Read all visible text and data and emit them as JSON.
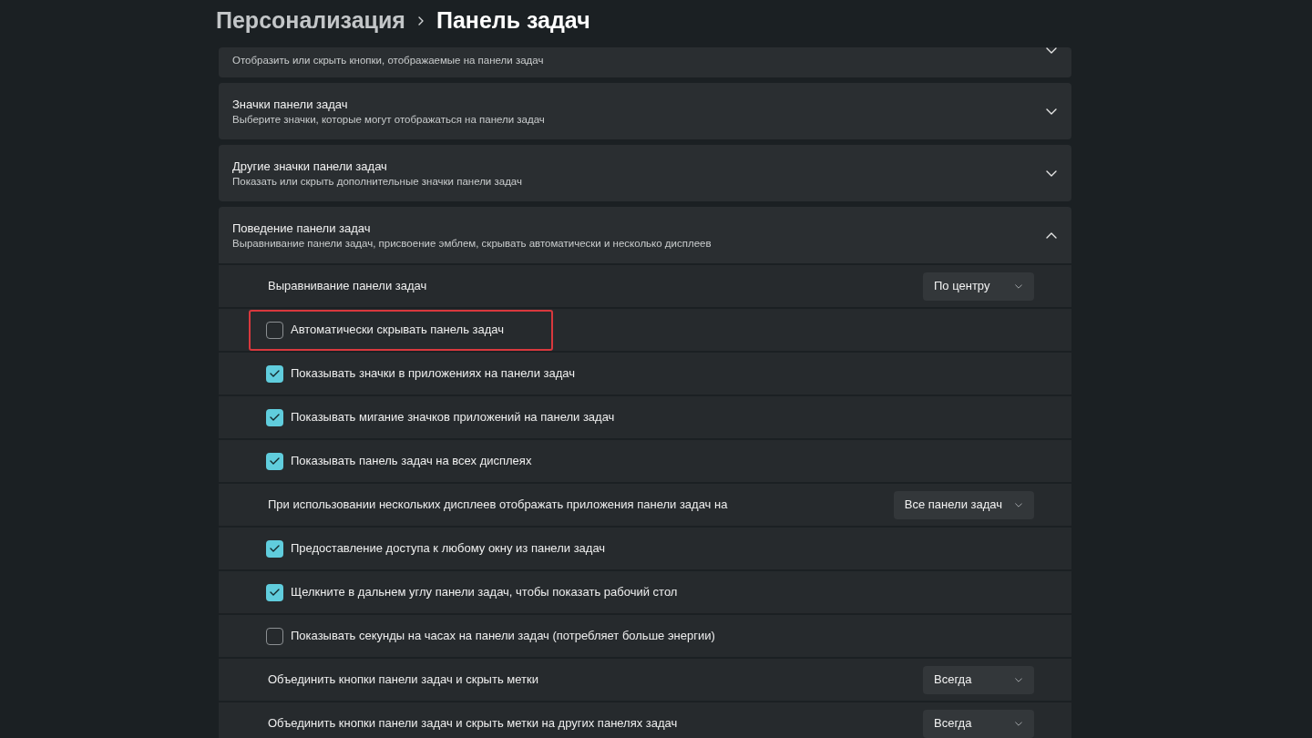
{
  "breadcrumb": {
    "parent": "Персонализация",
    "current": "Панель задач"
  },
  "sections": [
    {
      "subtitle": "Отобразить или скрыть кнопки, отображаемые на панели задач",
      "expanded": false
    },
    {
      "title": "Значки панели задач",
      "subtitle": "Выберите значки, которые могут отображаться на панели задач",
      "expanded": false
    },
    {
      "title": "Другие значки панели задач",
      "subtitle": "Показать или скрыть дополнительные значки панели задач",
      "expanded": false
    },
    {
      "title": "Поведение панели задач",
      "subtitle": "Выравнивание панели задач, присвоение эмблем, скрывать автоматически и несколько дисплеев",
      "expanded": true,
      "settings": [
        {
          "kind": "dropdown",
          "label": "Выравнивание панели задач",
          "value": "По центру"
        },
        {
          "kind": "checkbox",
          "label": "Автоматически скрывать панель задач",
          "checked": false,
          "highlighted": true
        },
        {
          "kind": "checkbox",
          "label": "Показывать значки в приложениях на панели задач",
          "checked": true,
          "highlighted": false
        },
        {
          "kind": "checkbox",
          "label": "Показывать мигание значков приложений на панели задач",
          "checked": true,
          "highlighted": false
        },
        {
          "kind": "checkbox",
          "label": "Показывать панель задач на всех дисплеях",
          "checked": true,
          "highlighted": false
        },
        {
          "kind": "dropdown",
          "label": "При использовании нескольких дисплеев отображать приложения панели задач на",
          "value": "Все панели задач"
        },
        {
          "kind": "checkbox",
          "label": "Предоставление доступа к любому окну из панели задач",
          "checked": true,
          "highlighted": false
        },
        {
          "kind": "checkbox",
          "label": "Щелкните в дальнем углу панели задач, чтобы показать рабочий стол",
          "checked": true,
          "highlighted": false
        },
        {
          "kind": "checkbox",
          "label": "Показывать секунды на часах на панели задач (потребляет больше энергии)",
          "checked": false,
          "highlighted": false
        },
        {
          "kind": "dropdown",
          "label": "Объединить кнопки панели задач и скрыть метки",
          "value": "Всегда"
        },
        {
          "kind": "dropdown",
          "label": "Объединить кнопки панели задач и скрыть метки на других панелях задач",
          "value": "Всегда"
        }
      ]
    }
  ]
}
